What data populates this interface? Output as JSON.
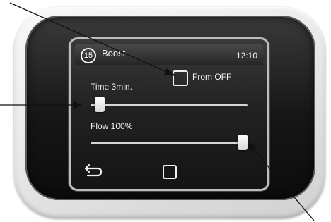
{
  "screen": {
    "header": {
      "badge": "15",
      "title": "Boost",
      "clock": "12:10"
    },
    "from_off": {
      "label": "From OFF",
      "checked": false
    },
    "sliders": [
      {
        "label": "Time 3min.",
        "fraction": 0.06
      },
      {
        "label": "Flow 100%",
        "fraction": 0.97
      }
    ],
    "nav": {
      "back_icon": "back-arrow-icon",
      "home_icon": "square-icon"
    }
  },
  "colors": {
    "screen_bg": "#222222",
    "text": "#f2f2f2",
    "shell": "#e6e6e6"
  }
}
